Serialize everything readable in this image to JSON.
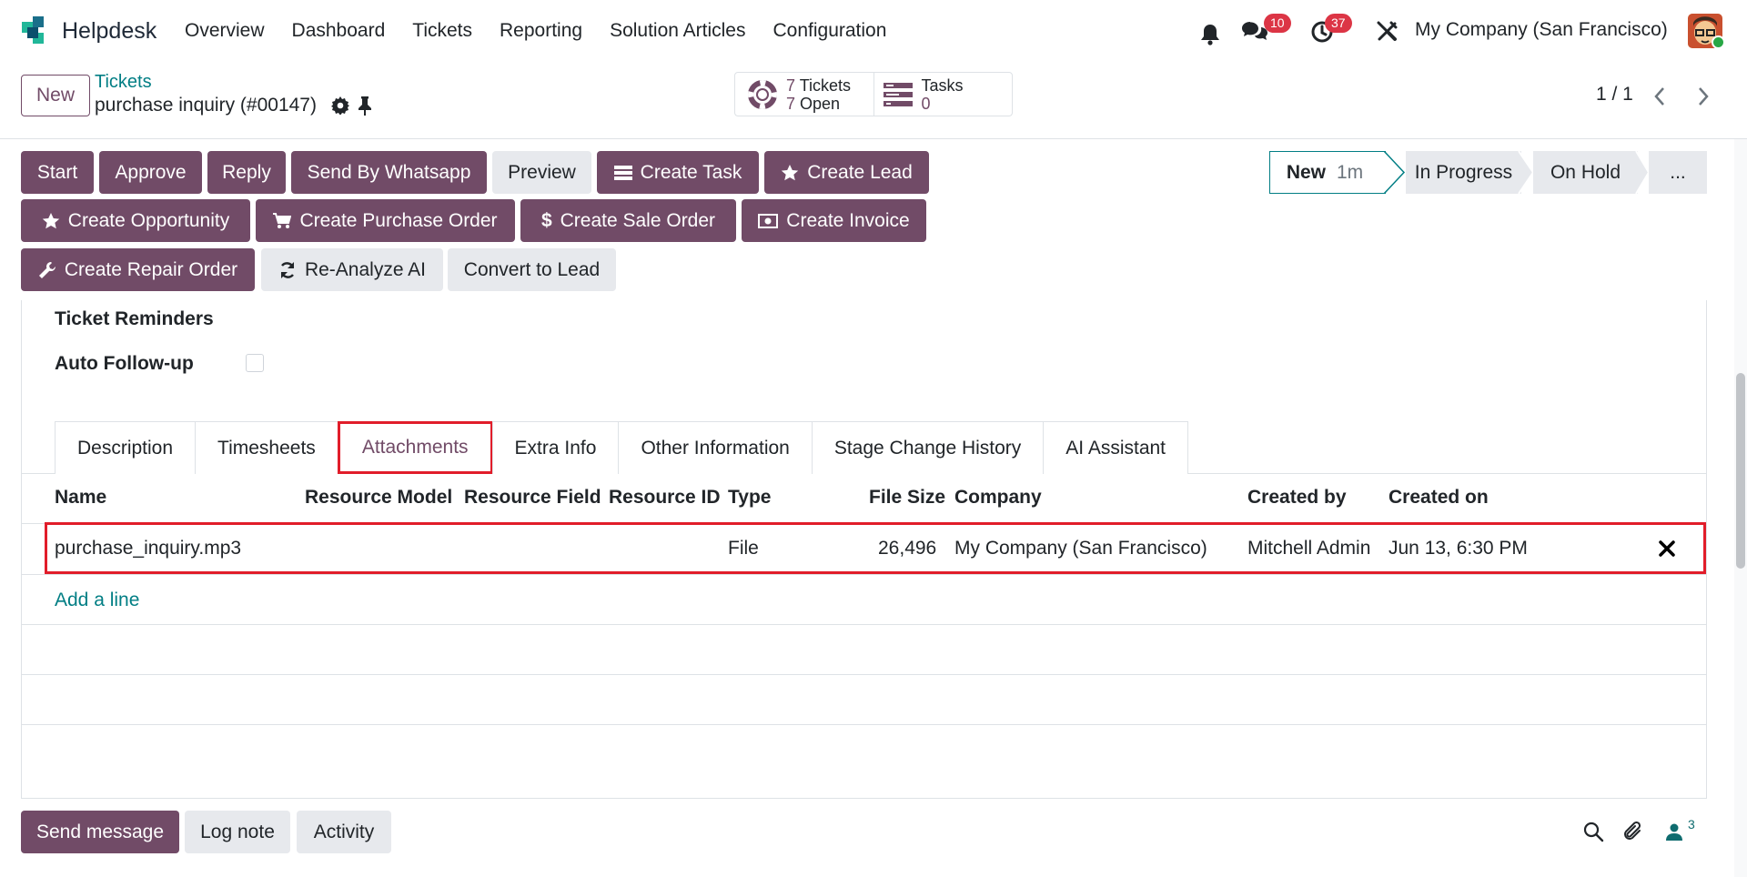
{
  "navbar": {
    "app_name": "Helpdesk",
    "menu": [
      "Overview",
      "Dashboard",
      "Tickets",
      "Reporting",
      "Solution Articles",
      "Configuration"
    ],
    "messages_badge": "10",
    "activities_badge": "37",
    "company": "My Company (San Francisco)"
  },
  "control": {
    "new_label": "New",
    "breadcrumb_parent": "Tickets",
    "breadcrumb_current": "purchase inquiry (#00147)",
    "smart_tickets_count": "7",
    "smart_tickets_label": "Tickets",
    "smart_open_count": "7",
    "smart_open_label": "Open",
    "smart_tasks_label": "Tasks",
    "smart_tasks_count": "0",
    "pager": "1 / 1"
  },
  "actions": {
    "row1": [
      "Start",
      "Approve",
      "Reply",
      "Send By Whatsapp",
      "Preview",
      "Create Task",
      "Create Lead"
    ],
    "row2": [
      "Create Opportunity",
      "Create Purchase Order",
      "Create Sale Order",
      "Create Invoice"
    ],
    "row3": [
      "Create Repair Order",
      "Re-Analyze AI",
      "Convert to Lead"
    ]
  },
  "statusbar": {
    "new_label": "New",
    "new_duration": "1m",
    "in_progress": "In Progress",
    "on_hold": "On Hold",
    "more": "..."
  },
  "form": {
    "ticket_reminders": "Ticket Reminders",
    "auto_followup": "Auto Follow-up",
    "auto_followup_checked": false
  },
  "tabs": [
    "Description",
    "Timesheets",
    "Attachments",
    "Extra Info",
    "Other Information",
    "Stage Change History",
    "AI Assistant"
  ],
  "active_tab": "Attachments",
  "attachments": {
    "columns": [
      "Name",
      "Resource Model",
      "Resource Field",
      "Resource ID",
      "Type",
      "File Size",
      "Company",
      "Created by",
      "Created on"
    ],
    "rows": [
      {
        "name": "purchase_inquiry.mp3",
        "resource_model": "",
        "resource_field": "",
        "resource_id": "",
        "type": "File",
        "file_size": "26,496",
        "company": "My Company (San Francisco)",
        "created_by": "Mitchell Admin",
        "created_on": "Jun 13, 6:30 PM"
      }
    ],
    "add_line": "Add a line"
  },
  "chatter": {
    "send_message": "Send message",
    "log_note": "Log note",
    "activity": "Activity",
    "followers_count": "3"
  },
  "colors": {
    "primary": "#714b67",
    "link": "#017e84",
    "highlight": "#e11d2a",
    "badge": "#dc3545"
  }
}
